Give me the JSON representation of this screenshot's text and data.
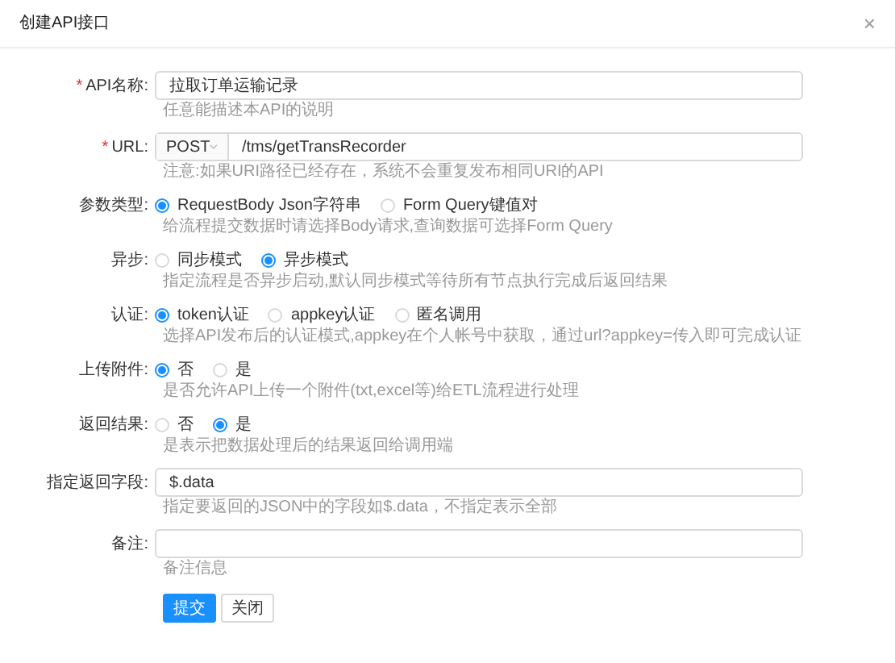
{
  "dialog": {
    "title": "创建API接口",
    "close": "×"
  },
  "fields": [
    {
      "kind": "text",
      "mark": "*",
      "label": "API名称:",
      "value": "拉取订单运输记录",
      "hint": "任意能描述本API的说明"
    },
    {
      "kind": "url",
      "mark": "*",
      "label": "URL:",
      "method": "POST",
      "value": "/tms/getTransRecorder",
      "hint": "注意:如果URI路径已经存在，系统不会重复发布相同URI的API"
    },
    {
      "kind": "radio",
      "label": "参数类型:",
      "options": [
        {
          "label": "RequestBody Json字符串",
          "selected": true
        },
        {
          "label": "Form Query键值对",
          "selected": false
        }
      ],
      "hint": "给流程提交数据时请选择Body请求,查询数据可选择Form Query"
    },
    {
      "kind": "radio",
      "label": "异步:",
      "options": [
        {
          "label": "同步模式",
          "selected": false
        },
        {
          "label": "异步模式",
          "selected": true
        }
      ],
      "hint": "指定流程是否异步启动,默认同步模式等待所有节点执行完成后返回结果"
    },
    {
      "kind": "radio",
      "label": "认证:",
      "options": [
        {
          "label": "token认证",
          "selected": true
        },
        {
          "label": "appkey认证",
          "selected": false
        },
        {
          "label": "匿名调用",
          "selected": false
        }
      ],
      "hint": "选择API发布后的认证模式,appkey在个人帐号中获取，通过url?appkey=传入即可完成认证"
    },
    {
      "kind": "radio",
      "label": "上传附件:",
      "options": [
        {
          "label": "否",
          "selected": true
        },
        {
          "label": "是",
          "selected": false
        }
      ],
      "hint": "是否允许API上传一个附件(txt,excel等)给ETL流程进行处理"
    },
    {
      "kind": "radio",
      "label": "返回结果:",
      "options": [
        {
          "label": "否",
          "selected": false
        },
        {
          "label": "是",
          "selected": true
        }
      ],
      "hint": "是表示把数据处理后的结果返回给调用端"
    },
    {
      "kind": "text",
      "label": "指定返回字段:",
      "value": "$.data",
      "hint": "指定要返回的JSON中的字段如$.data，不指定表示全部"
    },
    {
      "kind": "text",
      "label": "备注:",
      "hint": "备注信息"
    }
  ],
  "buttons": [
    {
      "kind": "primary",
      "label": "提交"
    },
    {
      "kind": "default",
      "label": "关闭"
    }
  ]
}
